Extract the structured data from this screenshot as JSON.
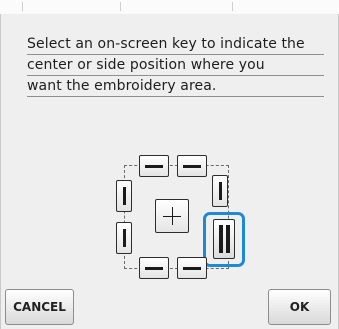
{
  "dialog": {
    "message_lines": [
      "Select an on-screen key to indicate the",
      "center or side position where you",
      "want the embroidery area."
    ]
  },
  "position_keys": {
    "selected": "right-bottom",
    "items": [
      "top-left",
      "top-right",
      "left-top",
      "left-bottom",
      "center",
      "right-top",
      "right-bottom",
      "bottom-left",
      "bottom-right"
    ]
  },
  "buttons": {
    "cancel_label": "CANCEL",
    "ok_label": "OK"
  },
  "colors": {
    "selection_ring": "#1e8ad6",
    "background": "#efefef"
  }
}
